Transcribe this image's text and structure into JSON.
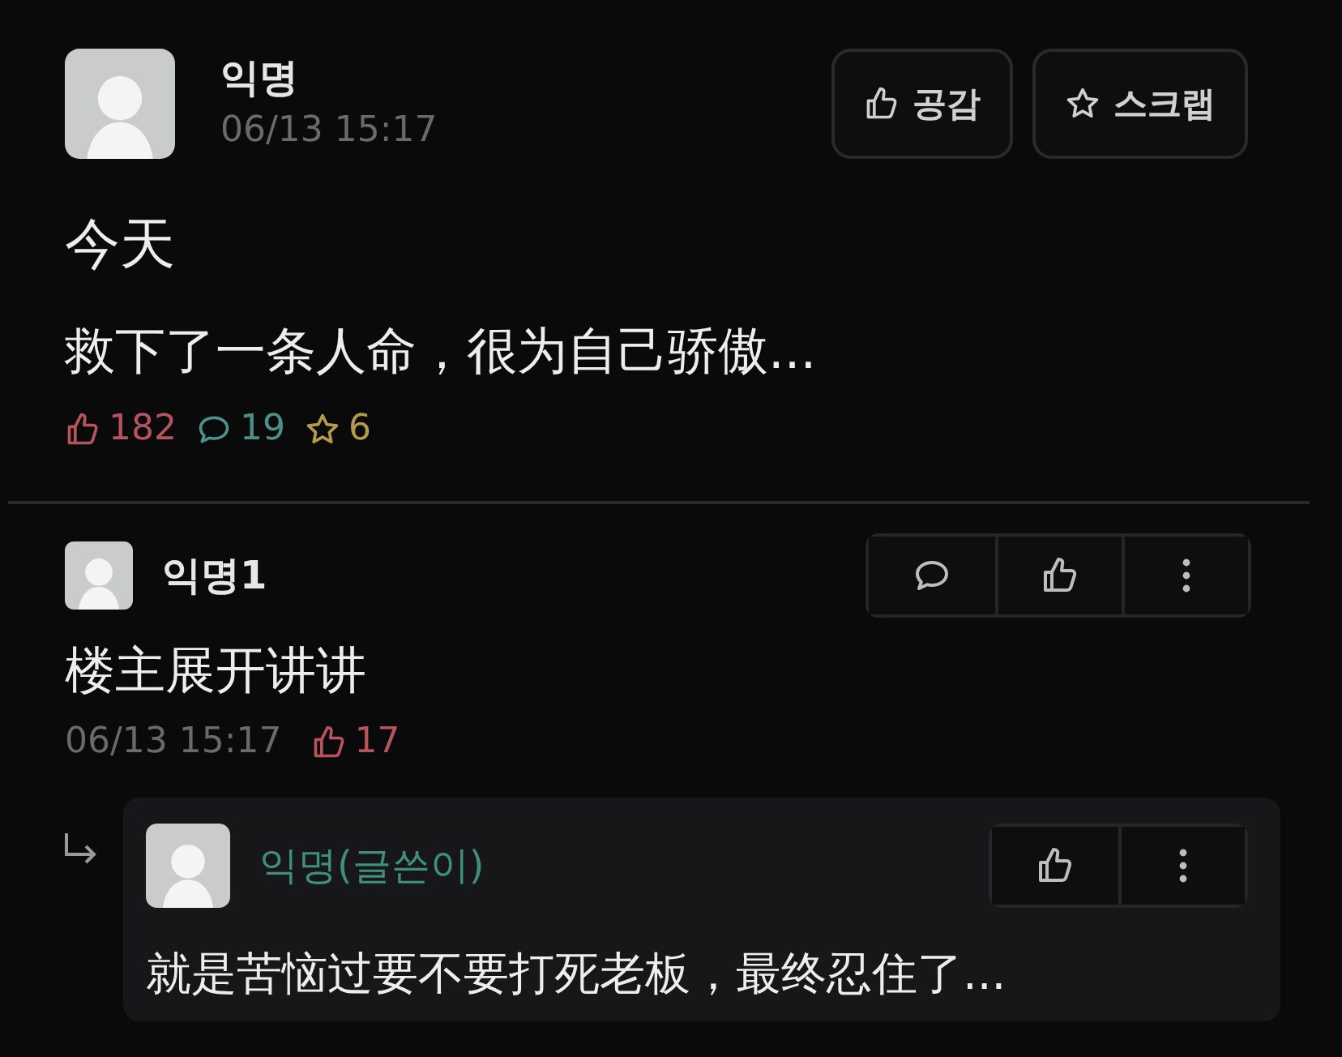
{
  "post": {
    "author": "익명",
    "time": "06/13 15:17",
    "title": "今天",
    "body": "救下了一条人命，很为自己骄傲...",
    "actions": [
      {
        "kind": "like",
        "label": "공감"
      },
      {
        "kind": "scrap",
        "label": "스크랩"
      }
    ],
    "stats": [
      {
        "kind": "like",
        "count": "182"
      },
      {
        "kind": "comment",
        "count": "19"
      },
      {
        "kind": "scrap",
        "count": "6"
      }
    ]
  },
  "comments": [
    {
      "author": "익명1",
      "is_writer": false,
      "body": "楼主展开讲讲",
      "time": "06/13 15:17",
      "likes": "17",
      "actions": [
        {
          "kind": "reply"
        },
        {
          "kind": "like"
        },
        {
          "kind": "more"
        }
      ],
      "replies": [
        {
          "author": "익명(글쓴이)",
          "is_writer": true,
          "body": "就是苦恼过要不要打死老板，最终忍住了...",
          "actions": [
            {
              "kind": "like"
            },
            {
              "kind": "more"
            }
          ]
        }
      ]
    }
  ]
}
